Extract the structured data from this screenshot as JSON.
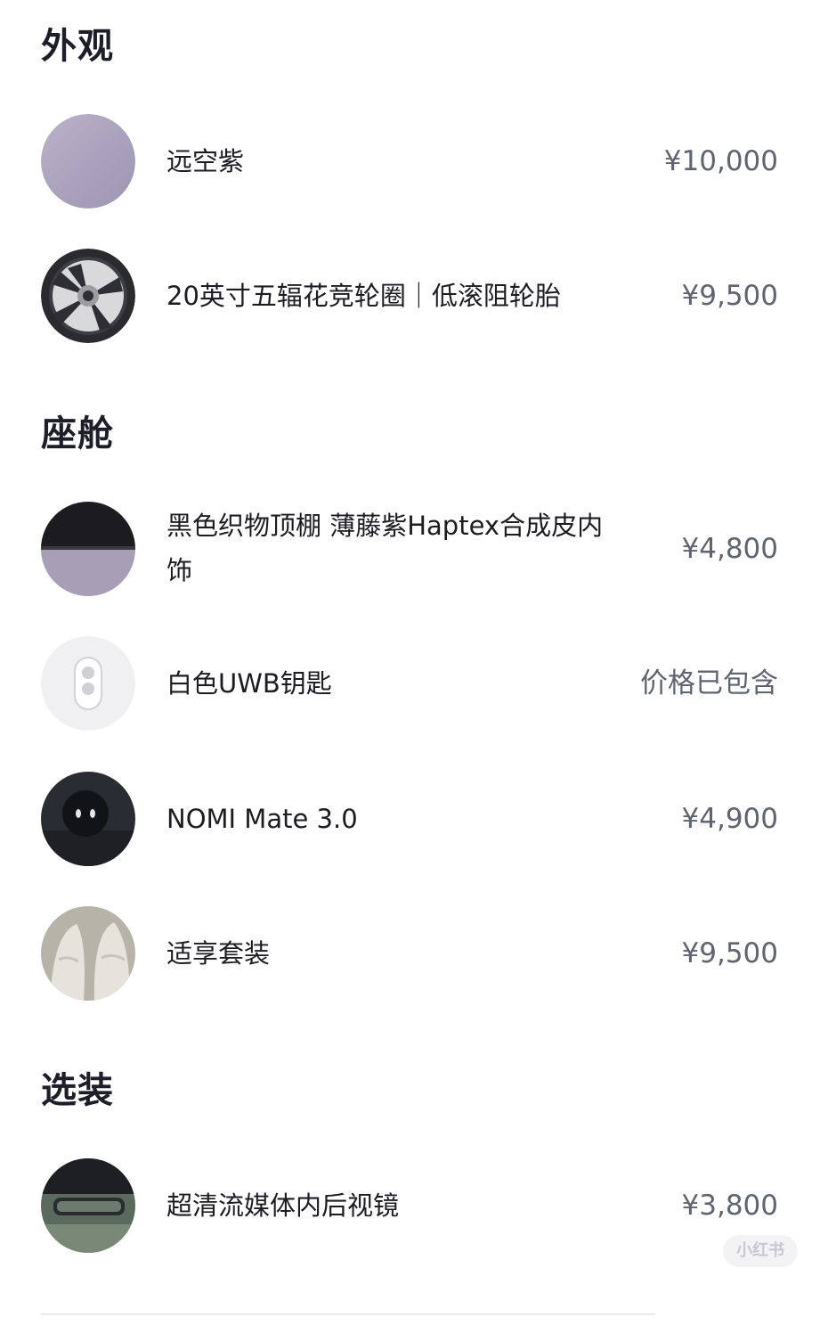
{
  "sections": {
    "exterior": {
      "title": "外观",
      "items": [
        {
          "name": "远空紫",
          "price": "¥10,000",
          "icon": "purple-paint-swatch"
        },
        {
          "name": "20英寸五辐花竞轮圈｜低滚阻轮胎",
          "price": "¥9,500",
          "icon": "wheel-rim"
        }
      ]
    },
    "cabin": {
      "title": "座舱",
      "items": [
        {
          "name": "黑色织物顶棚 薄藤紫Haptex合成皮内饰",
          "price": "¥4,800",
          "icon": "interior-swatch"
        },
        {
          "name": "白色UWB钥匙",
          "price": "价格已包含",
          "icon": "uwb-key"
        },
        {
          "name": "NOMI Mate 3.0",
          "price": "¥4,900",
          "icon": "nomi-robot"
        },
        {
          "name": "适享套装",
          "price": "¥9,500",
          "icon": "comfort-seats"
        }
      ]
    },
    "options": {
      "title": "选装",
      "items": [
        {
          "name": "超清流媒体内后视镜",
          "price": "¥3,800",
          "icon": "rearview-mirror"
        }
      ]
    }
  },
  "watermark": "小红书",
  "colors": {
    "title": "#1e1e2a",
    "text": "#1c1c24",
    "price": "#5f6470",
    "purple_swatch": "#aaa1bd"
  }
}
